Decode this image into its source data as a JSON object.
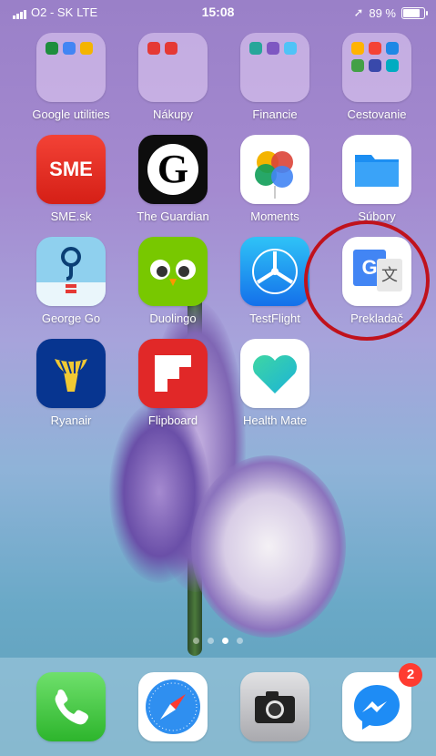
{
  "status_bar": {
    "carrier": "O2 - SK",
    "network": "LTE",
    "time": "15:08",
    "battery_percent": "89 %",
    "battery_level": 0.89
  },
  "apps": [
    {
      "label": "Google utilities",
      "icon": "folder-icon"
    },
    {
      "label": "Nákupy",
      "icon": "folder-icon"
    },
    {
      "label": "Financie",
      "icon": "folder-icon"
    },
    {
      "label": "Cestovanie",
      "icon": "folder-icon"
    },
    {
      "label": "SME.sk",
      "icon": "sme-icon",
      "text": "SME"
    },
    {
      "label": "The Guardian",
      "icon": "guardian-icon",
      "text": "G"
    },
    {
      "label": "Moments",
      "icon": "moments-icon"
    },
    {
      "label": "Súbory",
      "icon": "files-icon"
    },
    {
      "label": "George Go",
      "icon": "george-icon"
    },
    {
      "label": "Duolingo",
      "icon": "duolingo-icon"
    },
    {
      "label": "TestFlight",
      "icon": "testflight-icon"
    },
    {
      "label": "Prekladač",
      "icon": "translate-icon",
      "text": "G",
      "text2": "文"
    },
    {
      "label": "Ryanair",
      "icon": "ryanair-icon"
    },
    {
      "label": "Flipboard",
      "icon": "flipboard-icon"
    },
    {
      "label": "Health Mate",
      "icon": "healthmate-icon"
    }
  ],
  "page_indicator": {
    "pages": 4,
    "active": 3
  },
  "dock": [
    {
      "name": "Phone",
      "icon": "phone-icon"
    },
    {
      "name": "Safari",
      "icon": "safari-icon"
    },
    {
      "name": "Camera",
      "icon": "camera-icon"
    },
    {
      "name": "Messenger",
      "icon": "messenger-icon",
      "badge": "2"
    }
  ],
  "colors": {
    "highlight_ring": "#c0121c",
    "badge": "#ff3b30"
  }
}
